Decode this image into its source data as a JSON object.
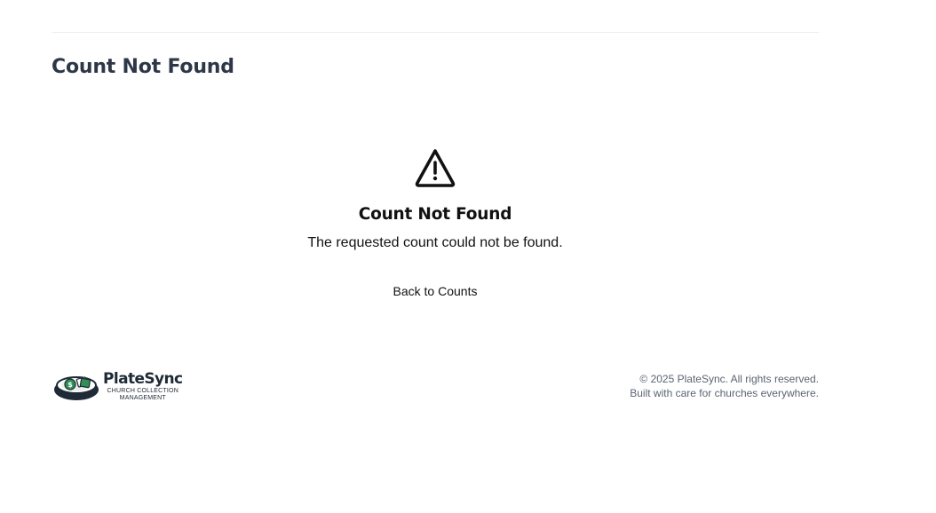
{
  "header": {
    "title": "Count Not Found"
  },
  "message": {
    "icon": "warning-triangle-icon",
    "title": "Count Not Found",
    "text": "The requested count could not be found.",
    "back_link": "Back to Counts"
  },
  "footer": {
    "logo": {
      "name": "PlateSync",
      "tagline_line1": "CHURCH COLLECTION",
      "tagline_line2": "MANAGEMENT"
    },
    "copyright": "© 2025 PlateSync. All rights reserved.",
    "tagline": "Built with care for churches everywhere."
  },
  "colors": {
    "title": "#2d3748",
    "text": "#111111",
    "muted": "#5b6472",
    "logo_green": "#2f8f55",
    "logo_navy": "#1f2a37"
  }
}
